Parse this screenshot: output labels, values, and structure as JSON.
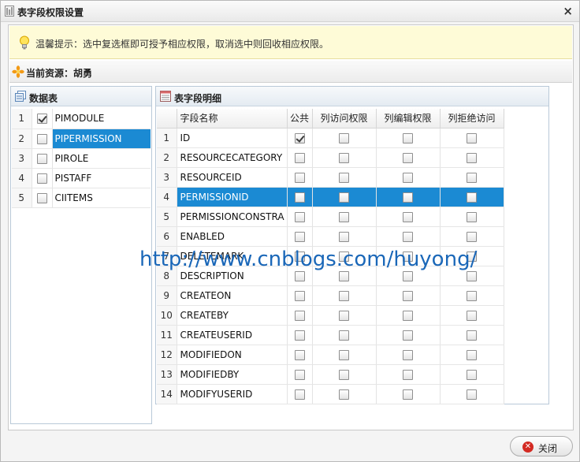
{
  "window": {
    "title": "表字段权限设置",
    "close_glyph": "×"
  },
  "tip": {
    "text": "温馨提示：选中复选框即可授予相应权限，取消选中则回收相应权限。"
  },
  "resource": {
    "label": "当前资源：胡勇"
  },
  "tables_panel": {
    "title": "数据表",
    "rows": [
      {
        "num": "1",
        "name": "PIMODULE",
        "checked": true,
        "selected": false
      },
      {
        "num": "2",
        "name": "PIPERMISSION",
        "checked": false,
        "selected": true
      },
      {
        "num": "3",
        "name": "PIROLE",
        "checked": false,
        "selected": false
      },
      {
        "num": "4",
        "name": "PISTAFF",
        "checked": false,
        "selected": false
      },
      {
        "num": "5",
        "name": "CIITEMS",
        "checked": false,
        "selected": false
      }
    ]
  },
  "fields_panel": {
    "title": "表字段明细",
    "headers": {
      "name": "字段名称",
      "public": "公共",
      "access": "列访问权限",
      "edit": "列编辑权限",
      "deny": "列拒绝访问"
    },
    "rows": [
      {
        "num": "1",
        "name": "ID",
        "public": true,
        "access": false,
        "edit": false,
        "deny": false,
        "selected": false
      },
      {
        "num": "2",
        "name": "RESOURCECATEGORY",
        "public": false,
        "access": false,
        "edit": false,
        "deny": false,
        "selected": false
      },
      {
        "num": "3",
        "name": "RESOURCEID",
        "public": false,
        "access": false,
        "edit": false,
        "deny": false,
        "selected": false
      },
      {
        "num": "4",
        "name": "PERMISSIONID",
        "public": false,
        "access": false,
        "edit": false,
        "deny": false,
        "selected": true
      },
      {
        "num": "5",
        "name": "PERMISSIONCONSTRA",
        "public": false,
        "access": false,
        "edit": false,
        "deny": false,
        "selected": false
      },
      {
        "num": "6",
        "name": "ENABLED",
        "public": false,
        "access": false,
        "edit": false,
        "deny": false,
        "selected": false
      },
      {
        "num": "7",
        "name": "DELETEMARK",
        "public": false,
        "access": false,
        "edit": false,
        "deny": false,
        "selected": false
      },
      {
        "num": "8",
        "name": "DESCRIPTION",
        "public": false,
        "access": false,
        "edit": false,
        "deny": false,
        "selected": false
      },
      {
        "num": "9",
        "name": "CREATEON",
        "public": false,
        "access": false,
        "edit": false,
        "deny": false,
        "selected": false
      },
      {
        "num": "10",
        "name": "CREATEBY",
        "public": false,
        "access": false,
        "edit": false,
        "deny": false,
        "selected": false
      },
      {
        "num": "11",
        "name": "CREATEUSERID",
        "public": false,
        "access": false,
        "edit": false,
        "deny": false,
        "selected": false
      },
      {
        "num": "12",
        "name": "MODIFIEDON",
        "public": false,
        "access": false,
        "edit": false,
        "deny": false,
        "selected": false
      },
      {
        "num": "13",
        "name": "MODIFIEDBY",
        "public": false,
        "access": false,
        "edit": false,
        "deny": false,
        "selected": false
      },
      {
        "num": "14",
        "name": "MODIFYUSERID",
        "public": false,
        "access": false,
        "edit": false,
        "deny": false,
        "selected": false
      }
    ]
  },
  "watermark": "http://www.cnblogs.com/huyong/",
  "footer": {
    "close_label": "关闭"
  },
  "colors": {
    "selection": "#1b8ad3",
    "tip_bg": "#fefbd7",
    "close_icon": "#d32a22"
  },
  "icons": {
    "window": "window-icon",
    "tip": "lightbulb-icon",
    "resource": "star-icon",
    "tables": "table-list-icon",
    "fields": "grid-detail-icon",
    "close_button": "close-circle-icon"
  }
}
